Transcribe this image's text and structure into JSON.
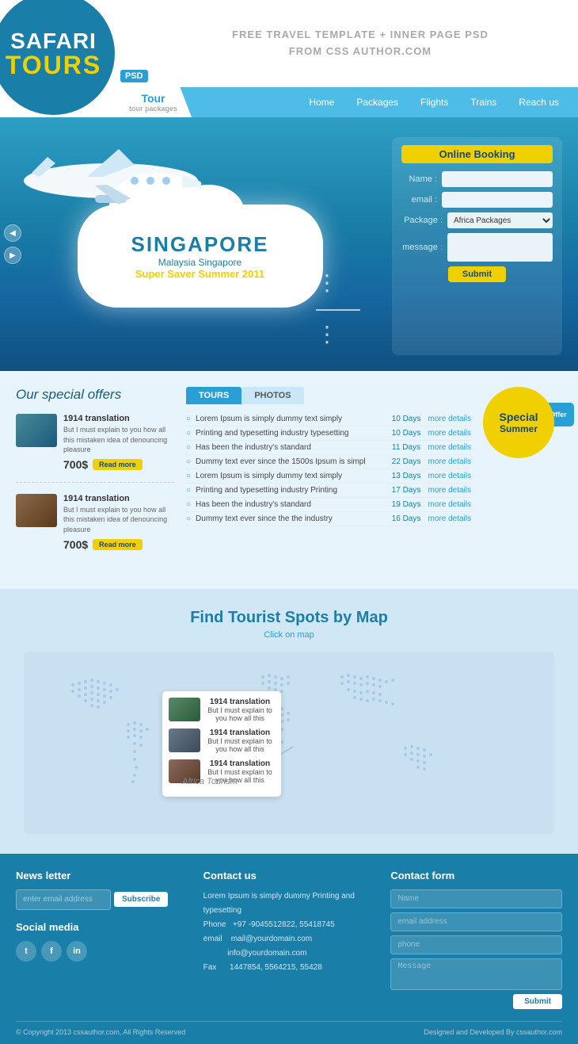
{
  "logo": {
    "safari": "SAFARI",
    "tours": "TOURS",
    "psd": "PSD"
  },
  "tagline": "FREE TRAVEL TEMPLATE + INNER PAGE PSD\nFROM CSS AUTHOR.COM",
  "nav": {
    "tour_label": "Tour",
    "tour_sub": "tour packages",
    "links": [
      "Home",
      "Packages",
      "Flights",
      "Trains",
      "Reach us"
    ]
  },
  "hero": {
    "destination": "SINGAPORE",
    "sub1": "Malaysia Singapore",
    "promo": "Super Saver Summer 2011"
  },
  "booking": {
    "title": "Online Booking",
    "name_label": "Name :",
    "email_label": "email :",
    "package_label": "Package :",
    "message_label": "message :",
    "package_option": "Africa Packages",
    "submit_label": "Submit"
  },
  "offers": {
    "title": "Our special offers",
    "cards": [
      {
        "name": "1914 translation",
        "desc": "But I must explain to you how all this mistaken idea of denouncing pleasure",
        "price": "700$",
        "btn": "Read more"
      },
      {
        "name": "1914 translation",
        "desc": "But I must explain to you how all this mistaken idea of denouncing pleasure",
        "price": "700$",
        "btn": "Read more"
      }
    ]
  },
  "tabs": {
    "tours": "TOURS",
    "photos": "PHOTOS"
  },
  "tour_rows": [
    {
      "name": "Lorem Ipsum is simply dummy text simply",
      "days": "10 Days",
      "more": "more details"
    },
    {
      "name": "Printing and typesetting industry typesetting",
      "days": "10 Days",
      "more": "more details"
    },
    {
      "name": "Has been the industry's standard",
      "days": "11 Days",
      "more": "more details"
    },
    {
      "name": "Dummy text ever since the 1500s Ipsum is simpl",
      "days": "22 Days",
      "more": "more details"
    },
    {
      "name": "Lorem Ipsum is simply dummy text simply",
      "days": "13 Days",
      "more": "more details"
    },
    {
      "name": "Printing and typesetting industry Printing",
      "days": "17 Days",
      "more": "more details"
    },
    {
      "name": "Has been the industry's standard",
      "days": "19 Days",
      "more": "more details"
    },
    {
      "name": "Dummy text ever since the the industry",
      "days": "16 Days",
      "more": "more details"
    }
  ],
  "special_badge": {
    "special": "Special",
    "summer": "Summer",
    "offer": "Offer"
  },
  "map": {
    "title": "Find Tourist Spots by Map",
    "subtitle": "Click on map",
    "africa_label": "Africa Tourism"
  },
  "map_items": [
    {
      "name": "1914 translation",
      "desc": "But I must explain to you how all this"
    },
    {
      "name": "1914 translation",
      "desc": "But I must explain to you how all this"
    },
    {
      "name": "1914 translation",
      "desc": "But I must explain to you how all this"
    }
  ],
  "footer": {
    "newsletter_title": "News letter",
    "newsletter_placeholder": "enter email address",
    "subscribe_btn": "Subscribe",
    "social_title": "Social media",
    "contact_title": "Contact us",
    "contact_desc": "Lorem Ipsum is simply dummy\nPrinting and typesetting",
    "phone_label": "Phone",
    "phone": "+97 -9045512822, 55418745",
    "email_label": "email",
    "email": "mail@yourdomain.com",
    "info_label": "",
    "info_email": "info@yourdomain.com",
    "fax_label": "Fax",
    "fax": "1447854, 5564215, 55428",
    "form_title": "Contact form",
    "name_placeholder": "Name",
    "email_placeholder": "email address",
    "phone_placeholder": "phone",
    "message_placeholder": "Message",
    "submit_btn": "Submit",
    "copyright": "© Copyright 2013 cssauthor.com, All Rights Reserved",
    "designed": "Designed and Developed By cssauthor.com"
  }
}
